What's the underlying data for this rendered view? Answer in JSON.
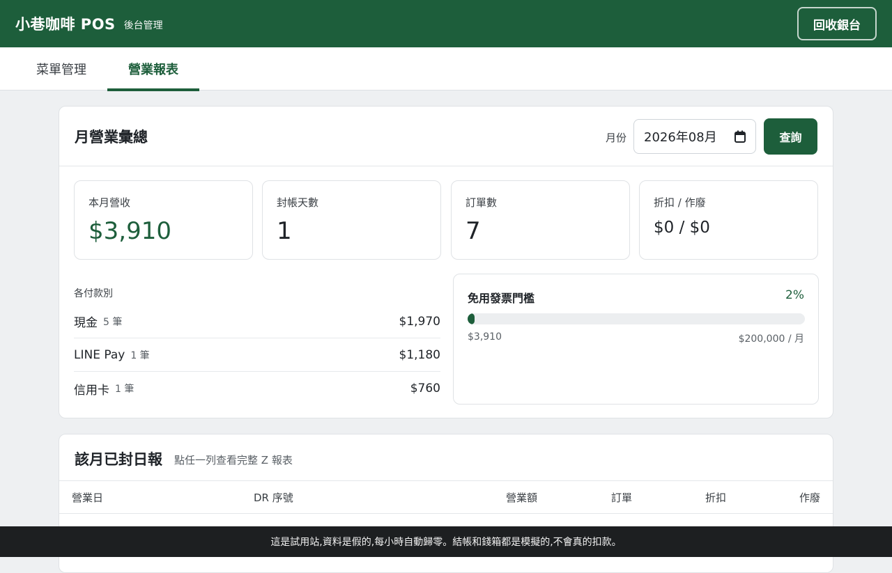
{
  "header": {
    "brand": "小巷咖啡 POS",
    "subtitle": "後台管理",
    "close_register_label": "回收銀台"
  },
  "tabs": [
    {
      "label": "菜單管理",
      "active": false
    },
    {
      "label": "營業報表",
      "active": true
    }
  ],
  "monthly": {
    "title": "月營業彙總",
    "month_label": "月份",
    "month_value": "2026年08月",
    "query_label": "查詢",
    "stats": [
      {
        "label": "本月營收",
        "value": "$3,910"
      },
      {
        "label": "封帳天數",
        "value": "1"
      },
      {
        "label": "訂單數",
        "value": "7"
      },
      {
        "label": "折扣 / 作廢",
        "value": "$0 / $0"
      }
    ],
    "payments_title": "各付款別",
    "payments": [
      {
        "name": "現金",
        "count": "5 筆",
        "amount": "$1,970"
      },
      {
        "name": "LINE Pay",
        "count": "1 筆",
        "amount": "$1,180"
      },
      {
        "name": "信用卡",
        "count": "1 筆",
        "amount": "$760"
      }
    ],
    "threshold": {
      "title": "免用發票門檻",
      "percent_label": "2%",
      "progress_fraction": 0.02,
      "current": "$3,910",
      "limit": "$200,000 / 月"
    }
  },
  "daily": {
    "title": "該月已封日報",
    "hint": "點任一列查看完整 Z 報表",
    "columns": [
      "營業日",
      "DR 序號",
      "營業額",
      "訂單",
      "折扣",
      "作廢"
    ]
  },
  "banner": "這是試用站,資料是假的,每小時自動歸零。結帳和錢箱都是模擬的,不會真的扣款。",
  "colors": {
    "brand_green": "#1d5e3b",
    "banner_bg": "#1d1f21"
  }
}
